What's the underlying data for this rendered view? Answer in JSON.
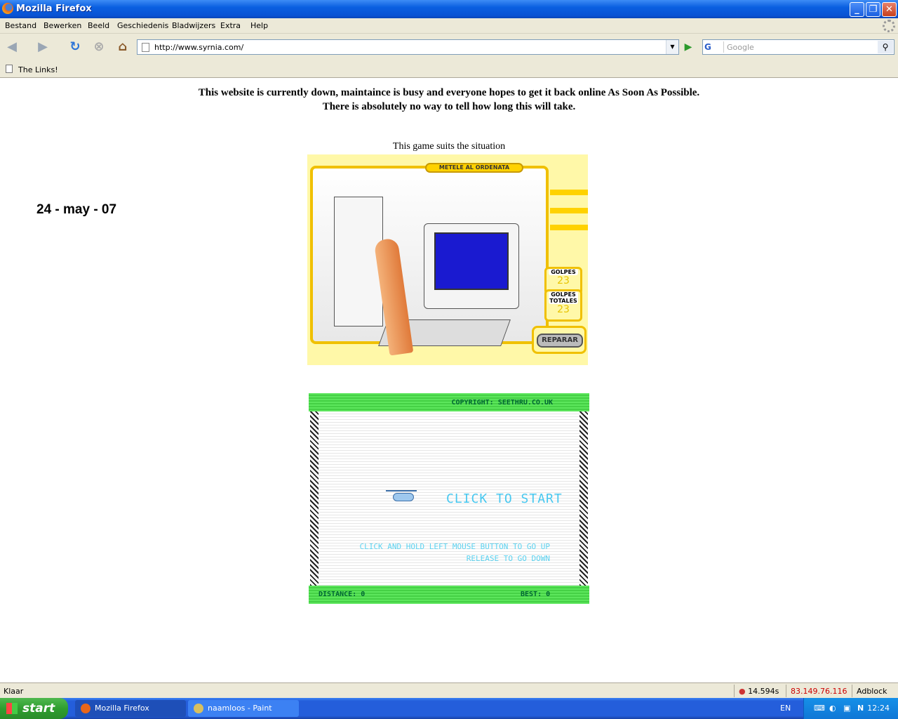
{
  "window": {
    "title": "Mozilla Firefox"
  },
  "menu": [
    "Bestand",
    "Bewerken",
    "Beeld",
    "Geschiedenis",
    "Bladwijzers",
    "Extra",
    "Help"
  ],
  "nav": {
    "url": "http://www.syrnia.com/",
    "search_placeholder": "Google",
    "search_engine": "G"
  },
  "bookmarks": [
    {
      "label": "The Links!"
    }
  ],
  "page": {
    "headline_line1": "This website is currently down, maintaince is busy and everyone hopes to get it back online As Soon As Possible.",
    "headline_line2": "There is absolutely no way to tell how long this will take.",
    "date": "24 - may - 07",
    "game_caption": "This game suits the situation"
  },
  "game1": {
    "banner": "METELE AL ORDENATA",
    "hits_label": "GOLPES",
    "hits_value": "23",
    "total_label": "GOLPES TOTALES",
    "total_value": "23",
    "repair_label": "REPARAR"
  },
  "game2": {
    "copyright": "COPYRIGHT: SEETHRU.CO.UK",
    "start": "CLICK TO START",
    "instruction1": "CLICK AND HOLD LEFT MOUSE BUTTON TO GO UP",
    "instruction2": "RELEASE TO GO DOWN",
    "distance_label": "DISTANCE:",
    "distance_value": "0",
    "best_label": "BEST:",
    "best_value": "0"
  },
  "status": {
    "text": "Klaar",
    "timer": "14.594s",
    "ip": "83.149.76.116",
    "addon": "Adblock"
  },
  "taskbar": {
    "start": "start",
    "tasks": [
      {
        "label": "Mozilla Firefox"
      },
      {
        "label": "naamloos - Paint"
      }
    ],
    "lang": "EN",
    "clock": "12:24"
  },
  "colors": {
    "titlebar": "#0a5fe0",
    "ip": "#cc0000",
    "start_green": "#2f9e2f",
    "game_green": "#5ce65c",
    "game_cyan": "#48c8f0",
    "game_yellow": "#f0c000"
  }
}
